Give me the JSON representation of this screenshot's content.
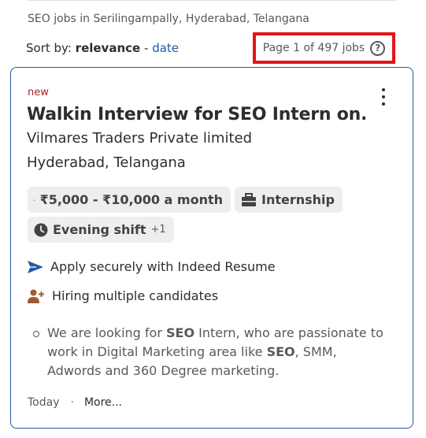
{
  "header": {
    "location_line": "SEO jobs in Serilingampally, Hyderabad, Telangana",
    "sort_prefix": "Sort by:",
    "sort_active": "relevance",
    "sort_separator": "-",
    "sort_alt": "date",
    "page_info": "Page 1 of 497 jobs",
    "help_glyph": "?"
  },
  "job": {
    "tag": "new",
    "title": "Walkin Interview for SEO Intern on...",
    "company": "Vilmares Traders Private limited",
    "location": "Hyderabad, Telangana",
    "salary": "₹5,000 - ₹10,000 a month",
    "job_type": "Internship",
    "shift": "Evening shift",
    "shift_extra": "+1",
    "features": {
      "apply": "Apply securely with Indeed Resume",
      "hiring": "Hiring multiple candidates"
    },
    "snippet": {
      "p1": "We are looking for ",
      "b1": "SEO",
      "p2": " Intern, who are passionate to work in Digital Marketing area like ",
      "b2": "SEO",
      "p3": ", SMM, Adwords and 360 Degree marketing."
    },
    "posted": "Today",
    "footer_dot": "·",
    "more": "More..."
  },
  "colors": {
    "accent": "#2557a7",
    "highlight_border": "#e3141b",
    "new_tag": "#a9252b",
    "hiring_icon": "#9d5b34",
    "chip_bg": "#efeeef"
  },
  "icons": {
    "salary": "money-icon",
    "job_type": "briefcase-icon",
    "shift": "clock-icon",
    "apply": "send-arrow-icon",
    "hiring": "add-person-icon",
    "help": "help-icon",
    "menu": "kebab-menu-icon"
  }
}
